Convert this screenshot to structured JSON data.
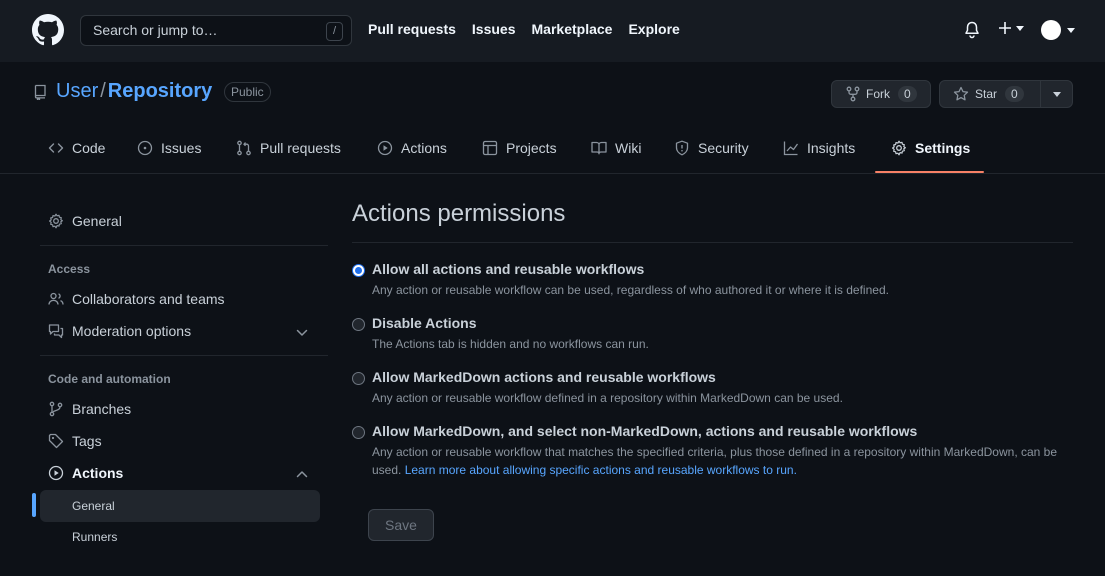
{
  "header": {
    "search_placeholder": "Search or jump to…",
    "search_key": "/",
    "nav": [
      "Pull requests",
      "Issues",
      "Marketplace",
      "Explore"
    ]
  },
  "repo": {
    "owner": "User",
    "separator": "/",
    "name": "Repository",
    "visibility": "Public",
    "fork_label": "Fork",
    "fork_count": "0",
    "star_label": "Star",
    "star_count": "0"
  },
  "tabs": [
    {
      "label": "Code",
      "icon": "code-icon"
    },
    {
      "label": "Issues",
      "icon": "issue-opened-icon"
    },
    {
      "label": "Pull requests",
      "icon": "git-pull-request-icon"
    },
    {
      "label": "Actions",
      "icon": "play-icon"
    },
    {
      "label": "Projects",
      "icon": "table-icon"
    },
    {
      "label": "Wiki",
      "icon": "book-icon"
    },
    {
      "label": "Security",
      "icon": "shield-icon"
    },
    {
      "label": "Insights",
      "icon": "graph-icon"
    },
    {
      "label": "Settings",
      "icon": "gear-icon",
      "active": true
    }
  ],
  "sidebar": {
    "general": "General",
    "access_heading": "Access",
    "collaborators": "Collaborators and teams",
    "moderation": "Moderation options",
    "code_heading": "Code and automation",
    "branches": "Branches",
    "tags": "Tags",
    "actions": "Actions",
    "actions_sub": [
      "General",
      "Runners"
    ]
  },
  "main": {
    "title": "Actions permissions",
    "options": [
      {
        "label": "Allow all actions and reusable workflows",
        "desc": "Any action or reusable workflow can be used, regardless of who authored it or where it is defined.",
        "checked": true
      },
      {
        "label": "Disable Actions",
        "desc": "The Actions tab is hidden and no workflows can run.",
        "checked": false
      },
      {
        "label": "Allow MarkedDown actions and reusable workflows",
        "desc": "Any action or reusable workflow defined in a repository within MarkedDown can be used.",
        "checked": false
      },
      {
        "label": "Allow MarkedDown, and select non-MarkedDown, actions and reusable workflows",
        "desc": "Any action or reusable workflow that matches the specified criteria, plus those defined in a repository within MarkedDown, can be used.",
        "link": "Learn more about allowing specific actions and reusable workflows to run.",
        "checked": false
      }
    ],
    "save_label": "Save"
  },
  "colors": {
    "background": "#0d1117",
    "header": "#161b22",
    "accent_link": "#58a6ff",
    "tab_underline": "#f78166"
  }
}
